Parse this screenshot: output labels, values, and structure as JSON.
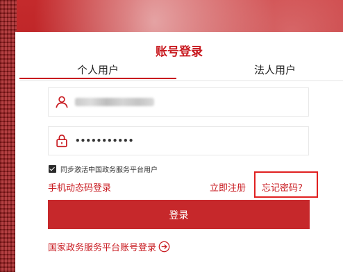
{
  "title": "账号登录",
  "tabs": {
    "personal": "个人用户",
    "legal": "法人用户"
  },
  "form": {
    "username_value": "",
    "password_value": "•••••••••••",
    "sync_checked": true,
    "sync_label": "同步激活中国政务服务平台用户"
  },
  "links": {
    "sms_login": "手机动态码登录",
    "register": "立即注册",
    "forgot": "忘记密码？",
    "gov_login": "国家政务服务平台账号登录"
  },
  "buttons": {
    "login": "登录"
  },
  "colors": {
    "accent": "#c8191f",
    "button": "#c6282b",
    "highlight": "#e02020"
  },
  "icons": {
    "user": "user-icon",
    "lock": "lock-icon",
    "arrow": "arrow-right-circle-icon"
  }
}
